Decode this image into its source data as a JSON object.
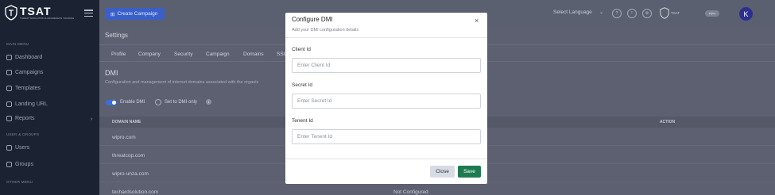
{
  "brand": {
    "name": "TSAT",
    "tagline": "THREAT SIMULATION & AWARENESS TRAINING"
  },
  "sidebar": {
    "sections": [
      {
        "label": "MAIN MENU"
      },
      {
        "label": "USER & GROUPS"
      },
      {
        "label": "OTHER MENU"
      }
    ],
    "items": [
      {
        "label": "Dashboard",
        "icon": "home-icon"
      },
      {
        "label": "Campaigns",
        "icon": "campaign-icon"
      },
      {
        "label": "Templates",
        "icon": "template-icon"
      },
      {
        "label": "Landing URL",
        "icon": "globe-icon"
      },
      {
        "label": "Reports",
        "icon": "report-icon"
      },
      {
        "label": "Users",
        "icon": "users-icon"
      },
      {
        "label": "Groups",
        "icon": "groups-icon"
      }
    ]
  },
  "topbar": {
    "create_label": "Create Campaign",
    "language_label": "Select Language",
    "brand_small": "TSAT",
    "partner_label": "wipro",
    "avatar_initial": "K"
  },
  "settings": {
    "title": "Settings",
    "tabs": [
      "Profile",
      "Company",
      "Security",
      "Campaign",
      "Domains",
      "SSO"
    ],
    "dmi_title": "DMI",
    "dmi_description": "Configuration and management of internet domains associated with the organiz",
    "enable_label": "Enable DMI",
    "dmi_only_label": "Set to DMI only",
    "table": {
      "headers": {
        "domain": "DOMAIN NAME",
        "action": "ACTION"
      },
      "rows": [
        {
          "domain": "wipro.com",
          "status": ""
        },
        {
          "domain": "threatcop.com",
          "status": ""
        },
        {
          "domain": "wipro-unza.com",
          "status": ""
        },
        {
          "domain": "techardsolution.com",
          "status": "Not Configured"
        }
      ]
    }
  },
  "modal": {
    "title": "Configure DMI",
    "subtitle": "Add your DMI configuration details",
    "fields": [
      {
        "label": "Client Id",
        "placeholder": "Enter Client Id"
      },
      {
        "label": "Secret Id",
        "placeholder": "Enter Secret Id"
      },
      {
        "label": "Tenent Id",
        "placeholder": "Enter Tenent Id"
      }
    ],
    "close_label": "Close",
    "save_label": "Save"
  },
  "colors": {
    "primary": "#3a5fc8",
    "save": "#1e7b50",
    "sidebar": "#1b2333"
  }
}
